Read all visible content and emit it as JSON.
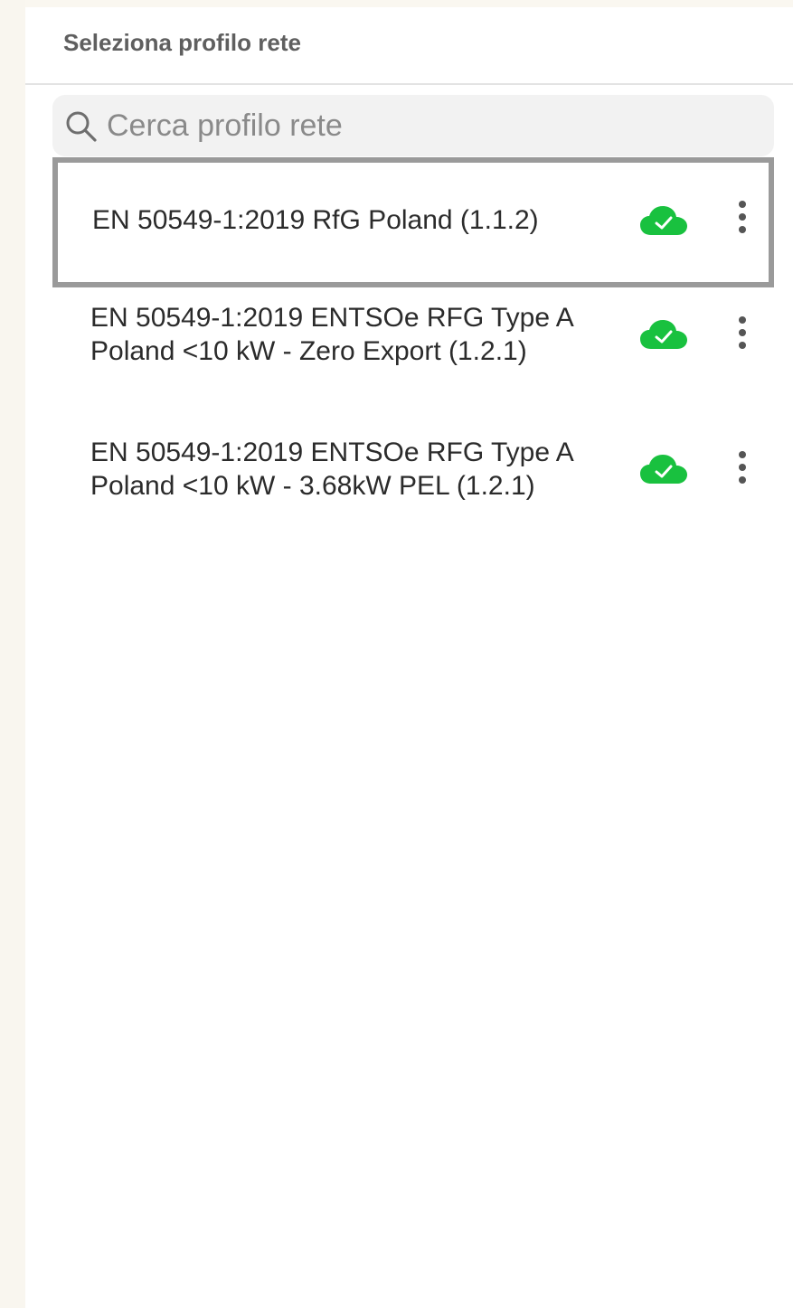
{
  "header": {
    "title": "Seleziona profilo rete"
  },
  "search": {
    "placeholder": "Cerca profilo rete",
    "value": ""
  },
  "profiles": [
    {
      "label": "EN 50549-1:2019 RfG Poland (1.1.2)",
      "status_icon": "cloud-check-icon",
      "selected": true
    },
    {
      "label": "EN 50549-1:2019 ENTSOe RFG Type A Poland <10 kW - Zero Export (1.2.1)",
      "status_icon": "cloud-check-icon",
      "selected": false
    },
    {
      "label": "EN 50549-1:2019 ENTSOe RFG Type A Poland <10 kW - 3.68kW PEL (1.2.1)",
      "status_icon": "cloud-check-icon",
      "selected": false
    }
  ],
  "colors": {
    "cloud_green": "#19c13f",
    "selection_border": "#9a9a9a",
    "background": "#faf7f0"
  }
}
